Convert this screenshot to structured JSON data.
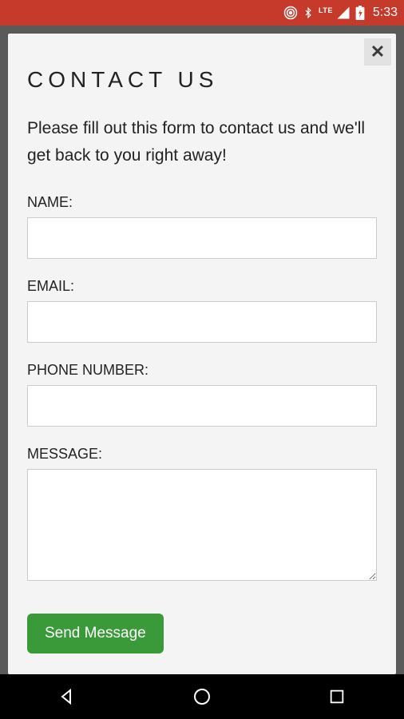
{
  "statusbar": {
    "lte": "LTE",
    "time": "5:33"
  },
  "modal": {
    "title": "CONTACT US",
    "intro": "Please fill out this form to contact us and we'll get back to you right away!",
    "fields": {
      "name_label": "NAME:",
      "email_label": "EMAIL:",
      "phone_label": "PHONE NUMBER:",
      "message_label": "MESSAGE:",
      "name_value": "",
      "email_value": "",
      "phone_value": "",
      "message_value": ""
    },
    "send_label": "Send Message",
    "close_label": "✕"
  }
}
